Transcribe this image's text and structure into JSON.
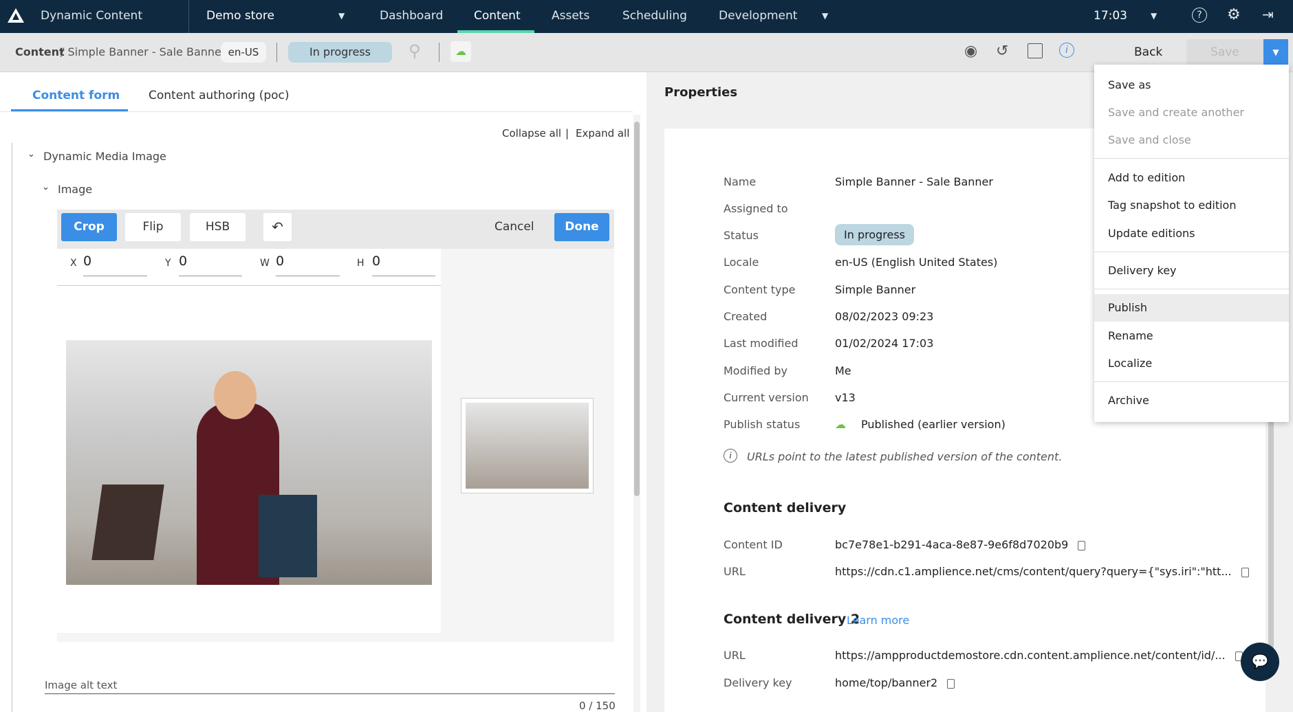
{
  "topbar": {
    "app_name": "Dynamic Content",
    "hub": "Demo store",
    "tabs": [
      "Dashboard",
      "Content",
      "Assets",
      "Scheduling",
      "Development"
    ],
    "active_tab": "Content",
    "time": "17:03",
    "accent": "#5ad4b0"
  },
  "subbar": {
    "breadcrumb_root": "Content",
    "breadcrumb_item": "/ Simple Banner - Sale Banner",
    "locale": "en-US",
    "status": "In progress",
    "back": "Back",
    "save": "Save"
  },
  "left": {
    "tabs": [
      "Content form",
      "Content authoring (poc)"
    ],
    "collapse_all": "Collapse all",
    "expand_all": "Expand all",
    "section": "Dynamic Media Image",
    "subsection": "Image",
    "toolbar": {
      "crop": "Crop",
      "flip": "Flip",
      "hsb": "HSB",
      "cancel": "Cancel",
      "done": "Done"
    },
    "fields": [
      {
        "label": "X",
        "value": "0"
      },
      {
        "label": "Y",
        "value": "0"
      },
      {
        "label": "W",
        "value": "0"
      },
      {
        "label": "H",
        "value": "0"
      }
    ],
    "alt_text_label": "Image alt text",
    "alt_count": "0 / 150"
  },
  "properties": {
    "title": "Properties",
    "rows": [
      {
        "label": "Name",
        "value": "Simple Banner - Sale Banner"
      },
      {
        "label": "Assigned to",
        "value": ""
      },
      {
        "label": "Status",
        "value": "In progress"
      },
      {
        "label": "Locale",
        "value": "en-US (English United States)"
      },
      {
        "label": "Content type",
        "value": "Simple Banner"
      },
      {
        "label": "Created",
        "value": "08/02/2023 09:23"
      },
      {
        "label": "Last modified",
        "value": "01/02/2024 17:03"
      },
      {
        "label": "Modified by",
        "value": "Me"
      },
      {
        "label": "Current version",
        "value": "v13"
      },
      {
        "label": "Publish status",
        "value": "Published (earlier version)"
      }
    ],
    "note": "URLs point to the latest published version of the content.",
    "delivery": {
      "title": "Content delivery",
      "content_id_label": "Content ID",
      "content_id": "bc7e78e1-b291-4aca-8e87-9e6f8d7020b9",
      "url_label": "URL",
      "url": "https://cdn.c1.amplience.net/cms/content/query?query={\"sys.iri\":\"htt..."
    },
    "delivery2": {
      "title": "Content delivery 2",
      "learn_more": "Learn more",
      "url_label": "URL",
      "url": "https://ampproductdemostore.cdn.content.amplience.net/content/id/...",
      "key_label": "Delivery key",
      "key": "home/top/banner2"
    }
  },
  "menu": {
    "items": [
      {
        "label": "Save as",
        "disabled": false
      },
      {
        "label": "Save and create another",
        "disabled": true
      },
      {
        "label": "Save and close",
        "disabled": true
      },
      {
        "label": "Add to edition"
      },
      {
        "label": "Tag snapshot to edition"
      },
      {
        "label": "Update editions"
      },
      {
        "label": "Delivery key"
      },
      {
        "label": "Publish"
      },
      {
        "label": "Rename"
      },
      {
        "label": "Localize"
      },
      {
        "label": "Archive"
      }
    ]
  }
}
